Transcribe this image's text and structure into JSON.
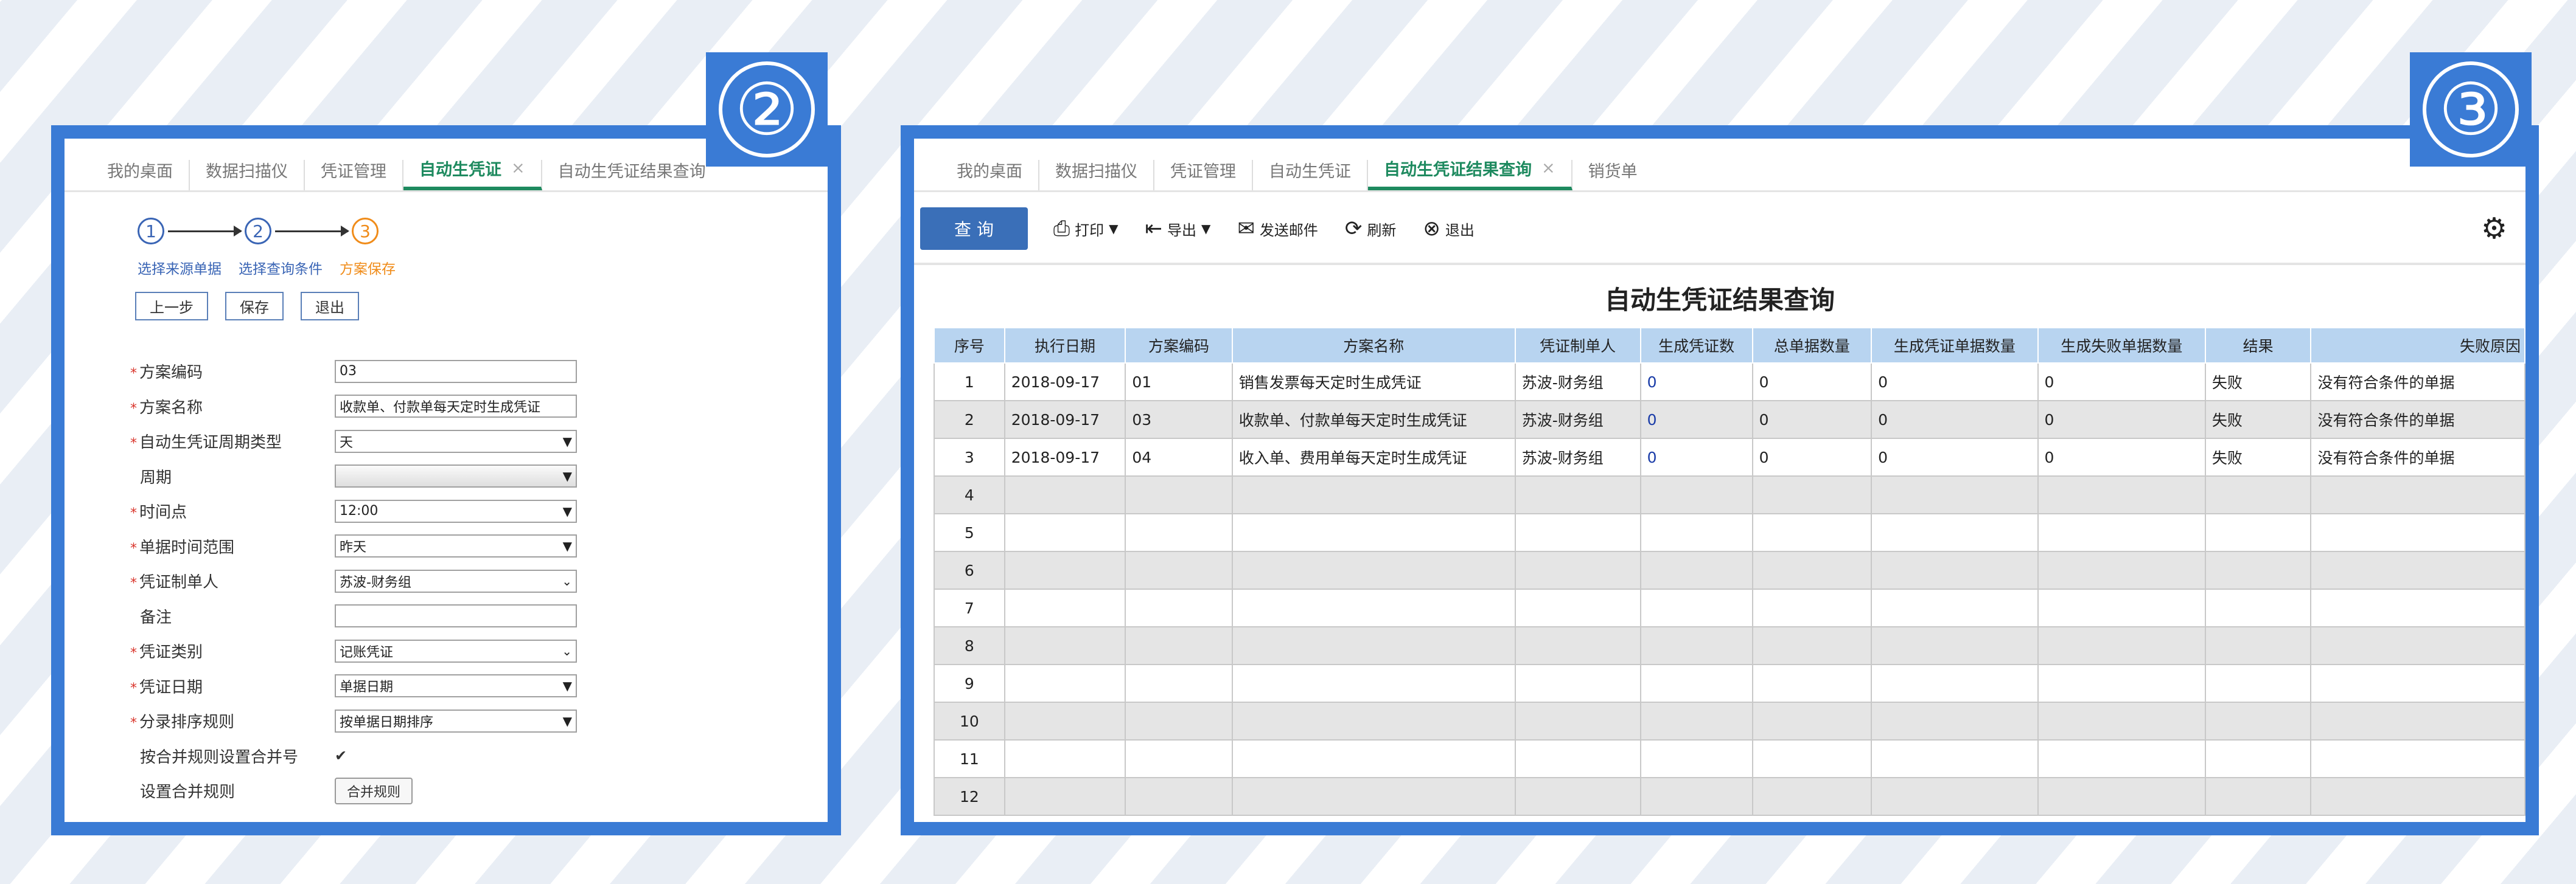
{
  "badges": {
    "left": "②",
    "right": "③"
  },
  "panel2": {
    "tabs": [
      {
        "label": "我的桌面"
      },
      {
        "label": "数据扫描仪"
      },
      {
        "label": "凭证管理"
      },
      {
        "label": "自动生凭证",
        "close": "×"
      },
      {
        "label": "自动生凭证结果查询"
      }
    ],
    "steps": {
      "numbers": [
        "1",
        "2",
        "3"
      ],
      "labels": [
        "选择来源单据",
        "选择查询条件",
        "方案保存"
      ]
    },
    "buttons": {
      "prev": "上一步",
      "save": "保存",
      "exit": "退出"
    },
    "form": {
      "scheme_code": {
        "label": "方案编码",
        "value": "03"
      },
      "scheme_name": {
        "label": "方案名称",
        "value": "收款单、付款单每天定时生成凭证"
      },
      "period_type": {
        "label": "自动生凭证周期类型",
        "value": "天"
      },
      "period": {
        "label": "周期",
        "value": ""
      },
      "time_point": {
        "label": "时间点",
        "value": "12:00"
      },
      "doc_range": {
        "label": "单据时间范围",
        "value": "昨天"
      },
      "maker": {
        "label": "凭证制单人",
        "value": "苏波-财务组"
      },
      "remark": {
        "label": "备注",
        "value": ""
      },
      "voucher_type": {
        "label": "凭证类别",
        "value": "记账凭证"
      },
      "voucher_date": {
        "label": "凭证日期",
        "value": "单据日期"
      },
      "entry_sort": {
        "label": "分录排序规则",
        "value": "按单据日期排序"
      },
      "merge_flag": {
        "label": "按合并规则设置合并号",
        "check": "✔"
      },
      "merge_rule": {
        "label": "设置合并规则",
        "button": "合并规则"
      }
    },
    "required_mark": "*"
  },
  "panel3": {
    "tabs": [
      {
        "label": "我的桌面"
      },
      {
        "label": "数据扫描仪"
      },
      {
        "label": "凭证管理"
      },
      {
        "label": "自动生凭证"
      },
      {
        "label": "自动生凭证结果查询",
        "close": "×"
      },
      {
        "label": "销货单"
      }
    ],
    "toolbar": {
      "query": "查 询",
      "print": "打印",
      "export": "导出",
      "email": "发送邮件",
      "refresh": "刷新",
      "exit": "退出"
    },
    "title": "自动生凭证结果查询",
    "columns": [
      "序号",
      "执行日期",
      "方案编码",
      "方案名称",
      "凭证制单人",
      "生成凭证数",
      "总单据数量",
      "生成凭证单据数量",
      "生成失败单据数量",
      "结果",
      "失败原因"
    ],
    "rows": [
      [
        "1",
        "2018-09-17",
        "01",
        "销售发票每天定时生成凭证",
        "苏波-财务组",
        "0",
        "0",
        "0",
        "0",
        "失败",
        "没有符合条件的单据"
      ],
      [
        "2",
        "2018-09-17",
        "03",
        "收款单、付款单每天定时生成凭证",
        "苏波-财务组",
        "0",
        "0",
        "0",
        "0",
        "失败",
        "没有符合条件的单据"
      ],
      [
        "3",
        "2018-09-17",
        "04",
        "收入单、费用单每天定时生成凭证",
        "苏波-财务组",
        "0",
        "0",
        "0",
        "0",
        "失败",
        "没有符合条件的单据"
      ],
      [
        "4",
        "",
        "",
        "",
        "",
        "",
        "",
        "",
        "",
        "",
        ""
      ],
      [
        "5",
        "",
        "",
        "",
        "",
        "",
        "",
        "",
        "",
        "",
        ""
      ],
      [
        "6",
        "",
        "",
        "",
        "",
        "",
        "",
        "",
        "",
        "",
        ""
      ],
      [
        "7",
        "",
        "",
        "",
        "",
        "",
        "",
        "",
        "",
        "",
        ""
      ],
      [
        "8",
        "",
        "",
        "",
        "",
        "",
        "",
        "",
        "",
        "",
        ""
      ],
      [
        "9",
        "",
        "",
        "",
        "",
        "",
        "",
        "",
        "",
        "",
        ""
      ],
      [
        "10",
        "",
        "",
        "",
        "",
        "",
        "",
        "",
        "",
        "",
        ""
      ],
      [
        "11",
        "",
        "",
        "",
        "",
        "",
        "",
        "",
        "",
        "",
        ""
      ],
      [
        "12",
        "",
        "",
        "",
        "",
        "",
        "",
        "",
        "",
        "",
        ""
      ]
    ]
  },
  "colors": {
    "accent": "#3a7bd5",
    "active_tab": "#1e8a5f",
    "header": "#b8d4f0",
    "step_current": "#f08c1a"
  }
}
